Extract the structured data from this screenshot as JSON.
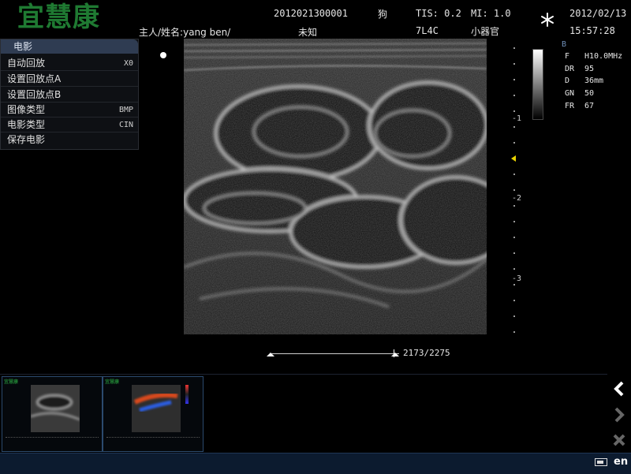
{
  "brand": {
    "logo_text": "宜慧康",
    "logo_color": "#1f7a32"
  },
  "header": {
    "patient_label": "主人/姓名:yang ben/",
    "exam_id": "2012021300001",
    "species": "狗",
    "unknown_label": "未知",
    "tis": "TIS: 0.2",
    "mi": "MI: 1.0",
    "probe": "7L4C",
    "organ_preset": "小器官",
    "freeze_icon": "snowflake-icon",
    "date": "2012/02/13",
    "time": "15:57:28"
  },
  "cine_menu": {
    "title": "电影",
    "items": [
      {
        "label": "自动回放",
        "value": "X0"
      },
      {
        "label": "设置回放点A",
        "value": ""
      },
      {
        "label": "设置回放点B",
        "value": ""
      },
      {
        "label": "图像类型",
        "value": "BMP"
      },
      {
        "label": "电影类型",
        "value": "CIN"
      },
      {
        "label": "保存电影",
        "value": ""
      }
    ]
  },
  "depth_scale": {
    "labels": [
      "-1",
      "-2",
      "-3"
    ]
  },
  "imaging_params": {
    "mode": "B",
    "rows": [
      {
        "key": "F",
        "value": "H10.0MHz"
      },
      {
        "key": "DR",
        "value": "95"
      },
      {
        "key": "D",
        "value": "36mm"
      },
      {
        "key": "GN",
        "value": "50"
      },
      {
        "key": "FR",
        "value": "67"
      }
    ]
  },
  "cine_progress": {
    "text": "2173/2275",
    "current": 2173,
    "total": 2275
  },
  "thumbnails": [
    {
      "type": "b-mode",
      "logo": "宜慧康"
    },
    {
      "type": "color-doppler",
      "logo": "宜慧康"
    }
  ],
  "nav": {
    "prev_icon": "chevron-left-icon",
    "next_icon": "chevron-right-icon",
    "close_icon": "close-icon"
  },
  "statusbar": {
    "language": "en",
    "keyboard_icon": "keyboard-icon"
  },
  "colors": {
    "menu_header": "#2f3c52",
    "thumb_border": "#2b4a6e",
    "statusbar_bg": "#0c1b2f"
  }
}
